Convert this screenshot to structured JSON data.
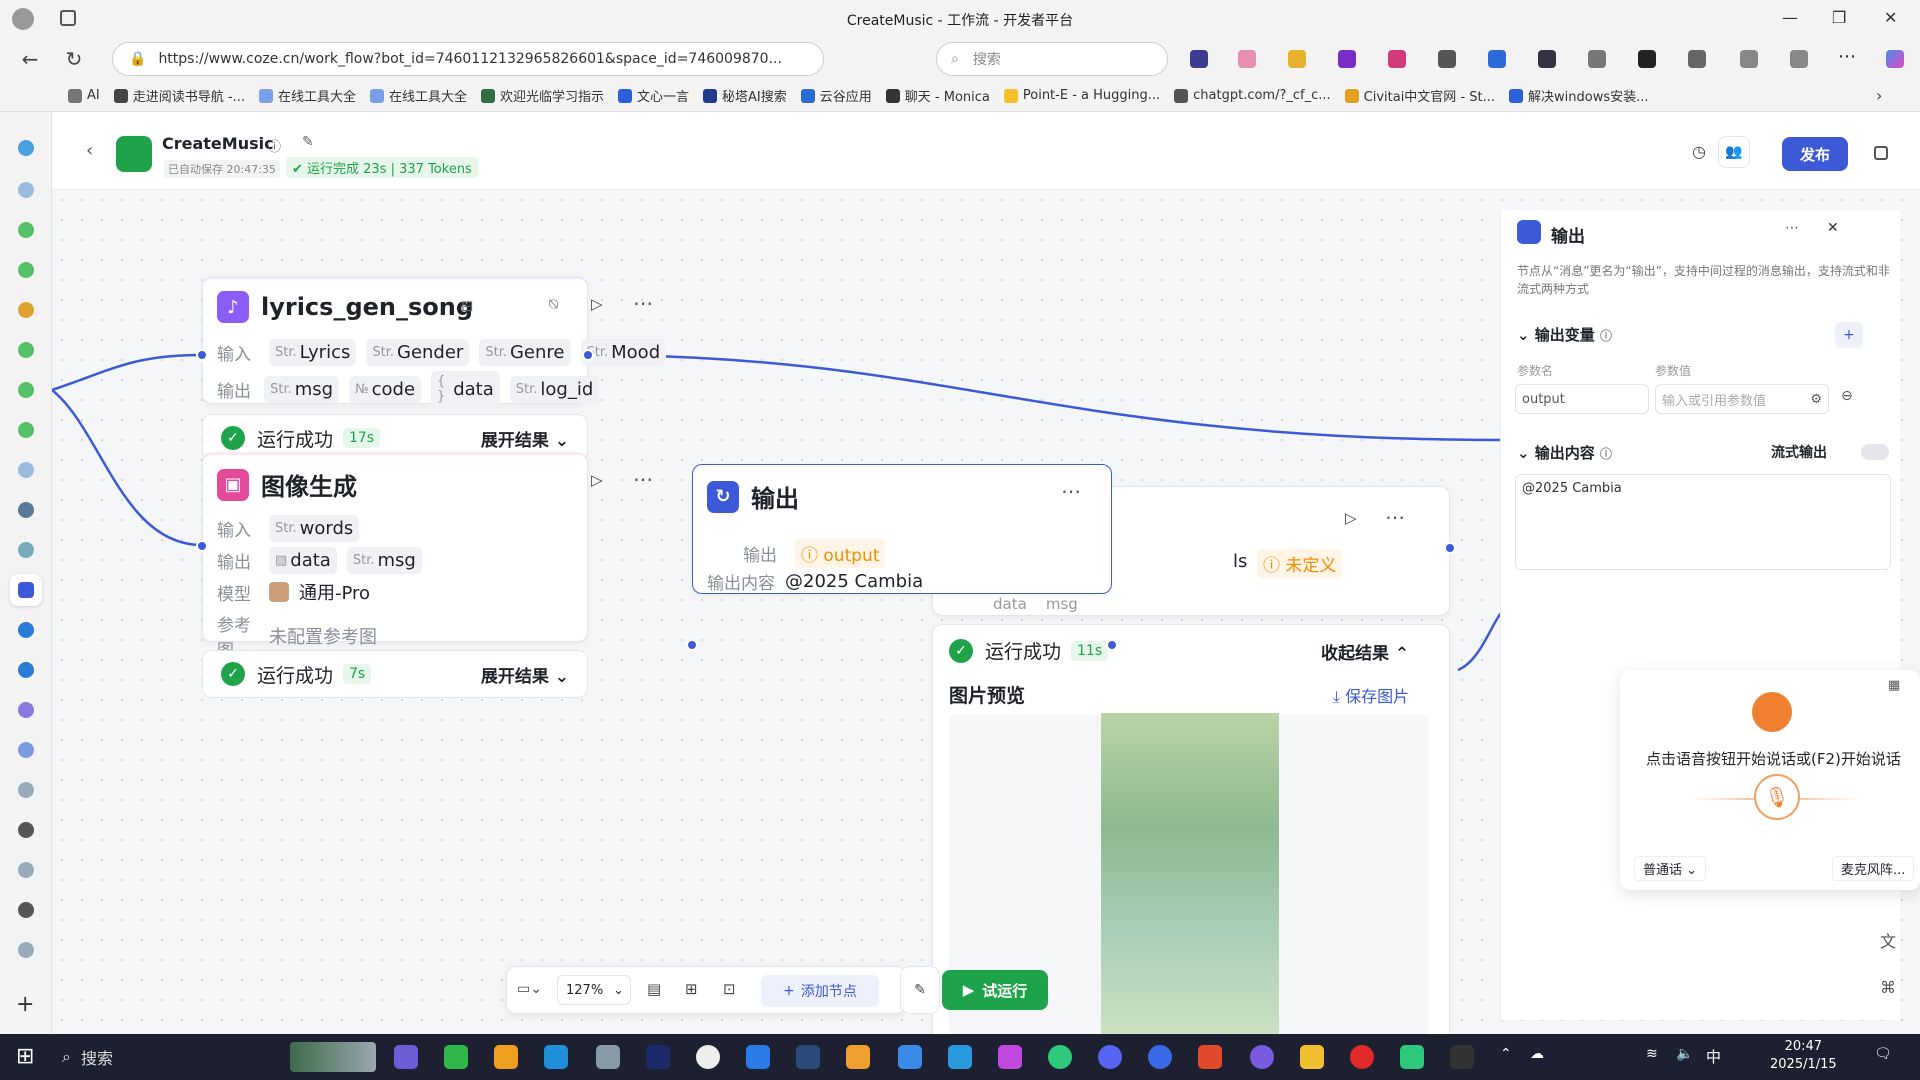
{
  "browser": {
    "title": "CreateMusic - 工作流 - 开发者平台",
    "url": "https://www.coze.cn/work_flow?bot_id=7460112132965826601&space_id=746009870...",
    "search_placeholder": "搜索",
    "bookmarks": [
      "AI",
      "走进阅读书导航 -...",
      "在线工具大全",
      "在线工具大全",
      "欢迎光临学习指示",
      "文心一言",
      "秘塔AI搜索",
      "云谷应用",
      "聊天 - Monica",
      "Point-E - a Hugging...",
      "chatgpt.com/?_cf_c...",
      "Civitai中文官网 - St...",
      "解决windows安装..."
    ]
  },
  "header": {
    "app_name": "CreateMusic",
    "saved_text": "已自动保存 20:47:35",
    "run_status": "运行完成 23s | 337 Tokens",
    "publish_label": "发布"
  },
  "nodes": {
    "lyrics": {
      "title": "lyrics_gen_song",
      "input_label": "输入",
      "output_label": "输出",
      "inputs": [
        "Lyrics",
        "Gender",
        "Genre",
        "Mood"
      ],
      "outputs": [
        {
          "type": "Str.",
          "name": "msg"
        },
        {
          "type": "№",
          "name": "code"
        },
        {
          "type": "{ }",
          "name": "data"
        },
        {
          "type": "Str.",
          "name": "log_id"
        }
      ],
      "type_prefix": "Str.",
      "result": "运行成功",
      "time": "17s",
      "expand": "展开结果"
    },
    "image": {
      "title": "图像生成",
      "input_label": "输入",
      "output_label": "输出",
      "model_label": "模型",
      "ref_label": "参考图",
      "input_value": "words",
      "outputs": [
        "data",
        "msg"
      ],
      "model": "通用-Pro",
      "ref_value": "未配置参考图",
      "result": "运行成功",
      "time": "7s",
      "expand": "展开结果"
    },
    "output_node": {
      "title": "输出",
      "out_label": "输出",
      "out_value": "output",
      "content_label": "输出内容",
      "content_value": "@2025 Cambia"
    },
    "hidden_node": {
      "partial_tag": "ls",
      "undefined_label": "未定义",
      "result": "运行成功",
      "time": "11s",
      "collapse": "收起结果",
      "preview_title": "图片预览",
      "save_image": "保存图片",
      "partial_row": "data    msg"
    }
  },
  "panel": {
    "title": "输出",
    "description": "节点从“消息”更名为“输出”，支持中间过程的消息输出，支持流式和非流式两种方式",
    "vars_title": "输出变量",
    "param_name_label": "参数名",
    "param_value_label": "参数值",
    "param_name_value": "output",
    "param_value_placeholder": "输入或引用参数值",
    "content_title": "输出内容",
    "stream_label": "流式输出",
    "content_value": "@2025 Cambia"
  },
  "voice": {
    "prompt": "点击语音按钮开始说话或(F2)开始说话",
    "language": "普通话",
    "mic": "麦克风阵..."
  },
  "toolbar": {
    "zoom": "127%",
    "add_node": "添加节点",
    "run": "试运行"
  },
  "taskbar": {
    "search": "搜索",
    "time": "20:47",
    "date": "2025/1/15",
    "ime": "中"
  },
  "colors": {
    "accent": "#3c5ad8",
    "success": "#1fa34a",
    "warning": "#f08c00",
    "run_button": "#1fa34a"
  }
}
